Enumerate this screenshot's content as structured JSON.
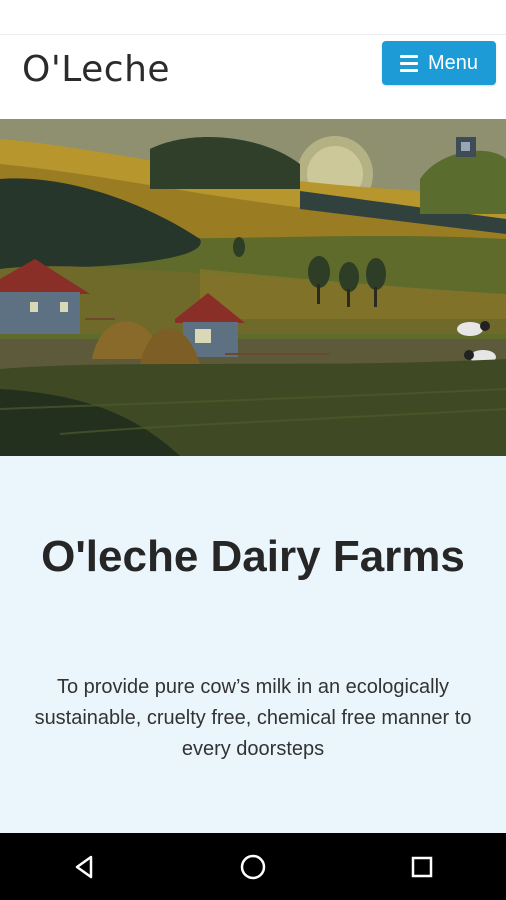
{
  "header": {
    "logo_text": "O'Leche",
    "menu_label": "Menu"
  },
  "intro": {
    "title": "O'leche Dairy Farms",
    "tagline": "To provide pure cow’s milk in an ecologically sustainable, cruelty free, chemical free manner to every doorsteps"
  },
  "system_nav": {
    "icons": [
      "back-icon",
      "home-icon",
      "recents-icon"
    ]
  },
  "colors": {
    "menu_button": "#1d9bd6",
    "intro_background": "#eaf6fc",
    "title_text": "#262626"
  }
}
